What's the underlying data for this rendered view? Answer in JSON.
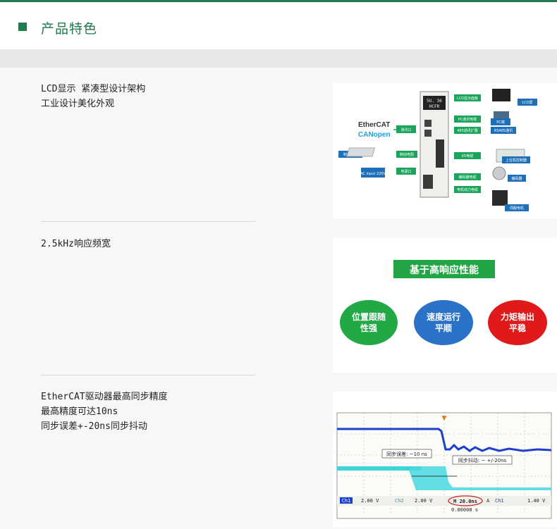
{
  "header": {
    "title": "产品特色"
  },
  "features": [
    {
      "lines": [
        "LCD显示  紧凑型设计架构",
        "工业设计美化外观"
      ]
    },
    {
      "lines": [
        "2.5kHz响应频宽"
      ]
    },
    {
      "lines": [
        "EtherCAT驱动器最高同步精度",
        "最高精度可达10ns",
        "同步误差+-20ns同步抖动"
      ]
    }
  ],
  "diagram": {
    "protocols": [
      "EtherCAT",
      "CANopen"
    ],
    "device_display": "5U. 36",
    "device_display2": "HCFR",
    "ports": [
      "LCD显示面板",
      "PC通讯电缆",
      "485通讯扩展",
      "通讯口",
      "制动电阻",
      "电源口",
      "I/O电缆",
      "编码器电缆",
      "电机动力电缆"
    ],
    "peripherals": [
      "LCD屏",
      "PC端",
      "RS485通讯",
      "制动电阻",
      "AC input 220V",
      "上位机控制器",
      "编码器",
      "伺服电机"
    ]
  },
  "performance": {
    "banner": "基于高响应性能",
    "circles": [
      {
        "line1": "位置跟随",
        "line2": "性强",
        "color": "#22a845"
      },
      {
        "line1": "速度运行",
        "line2": "平顺",
        "color": "#2a72c7"
      },
      {
        "line1": "力矩输出",
        "line2": "平稳",
        "color": "#e01a1a"
      }
    ]
  },
  "scope": {
    "annotation1": "同步误差: ~10 ns",
    "annotation2": "同步抖动: ~ +/-20ns",
    "status": [
      "Ch1",
      "2.00 V",
      "Ch2",
      "2.00 V",
      "M 20.0ns",
      "A",
      "Ch1",
      "1.40 V"
    ],
    "trigger": "0.00000 s"
  },
  "colors": {
    "accent": "#1f7a4c"
  }
}
